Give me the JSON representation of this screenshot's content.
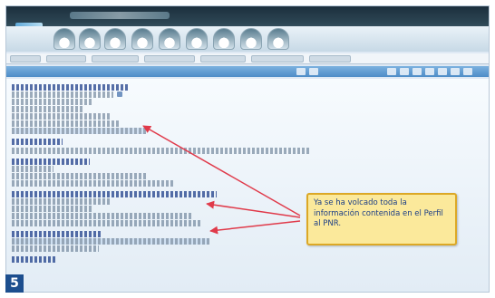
{
  "callout": {
    "text": "Ya se ha volcado toda la información contenida en el Perfil al PNR."
  },
  "step": {
    "number": "5"
  },
  "colors": {
    "callout_bg": "#fbe99b",
    "callout_border": "#dca826",
    "callout_text": "#1d3f86",
    "arrow": "#e03a4a",
    "badge_bg": "#1c4e8e"
  },
  "icons": [
    "app-logo-icon",
    "toolbar-icon"
  ]
}
